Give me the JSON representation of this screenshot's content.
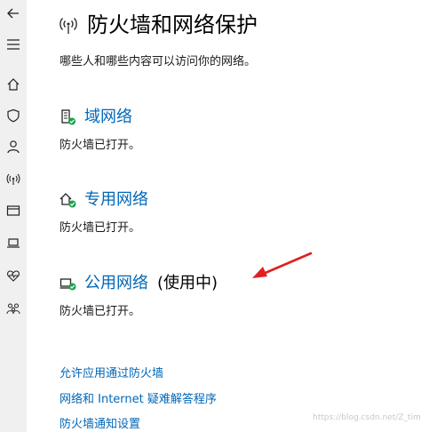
{
  "page": {
    "title": "防火墙和网络保护",
    "subtitle": "哪些人和哪些内容可以访问你的网络。"
  },
  "sidebar": {
    "items": [
      {
        "icon": "back-arrow-icon"
      },
      {
        "icon": "hamburger-menu-icon"
      },
      {
        "icon": "home-icon"
      },
      {
        "icon": "shield-icon"
      },
      {
        "icon": "person-icon"
      },
      {
        "icon": "wifi-signal-icon"
      },
      {
        "icon": "browser-window-icon"
      },
      {
        "icon": "laptop-icon"
      },
      {
        "icon": "heart-pulse-icon"
      },
      {
        "icon": "family-icon"
      }
    ]
  },
  "networks": [
    {
      "name": "域网络",
      "status": "防火墙已打开。",
      "in_use": "",
      "icon": "domain-network-icon"
    },
    {
      "name": "专用网络",
      "status": "防火墙已打开。",
      "in_use": "",
      "icon": "private-network-icon"
    },
    {
      "name": "公用网络",
      "status": "防火墙已打开。",
      "in_use": "(使用中)",
      "icon": "public-network-icon"
    }
  ],
  "links": [
    {
      "label": "允许应用通过防火墙"
    },
    {
      "label": "网络和 Internet 疑难解答程序"
    },
    {
      "label": "防火墙通知设置"
    }
  ],
  "watermark": "https://blog.csdn.net/Z_timer",
  "colors": {
    "accent": "#0067b8",
    "status_ok": "#16a34a",
    "annotation_arrow": "#e02020"
  }
}
